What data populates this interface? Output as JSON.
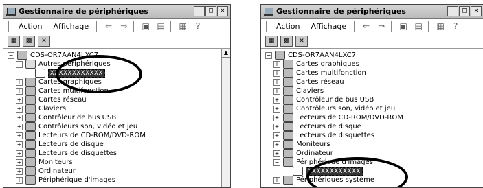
{
  "left": {
    "title": "Gestionnaire de périphériques",
    "menu": {
      "action": "Action",
      "view": "Affichage"
    },
    "root": "CDS-OR7AAN4LXC7",
    "other": "Autres périphériques",
    "hidden": "XXXXXXXXXXXX",
    "items": [
      "Cartes graphiques",
      "Cartes multifonction",
      "Cartes réseau",
      "Claviers",
      "Contrôleur de bus USB",
      "Contrôleurs son, vidéo et jeu",
      "Lecteurs de CD-ROM/DVD-ROM",
      "Lecteurs de disque",
      "Lecteurs de disquettes",
      "Moniteurs",
      "Ordinateur",
      "Périphérique d'images"
    ]
  },
  "right": {
    "title": "Gestionnaire de périphériques",
    "menu": {
      "action": "Action",
      "view": "Affichage"
    },
    "root": "CDS-OR7AAN4LXC7",
    "items": [
      "Cartes graphiques",
      "Cartes multifonction",
      "Cartes réseau",
      "Claviers",
      "Contrôleur de bus USB",
      "Contrôleurs son, vidéo et jeu",
      "Lecteurs de CD-ROM/DVD-ROM",
      "Lecteurs de disque",
      "Lecteurs de disquettes",
      "Moniteurs",
      "Ordinateur",
      "Périphérique d'images"
    ],
    "hidden": "XXXXXXXXXXXX",
    "last": "Périphériques système"
  },
  "buttons": {
    "min": "_",
    "max": "□",
    "close": "×"
  }
}
